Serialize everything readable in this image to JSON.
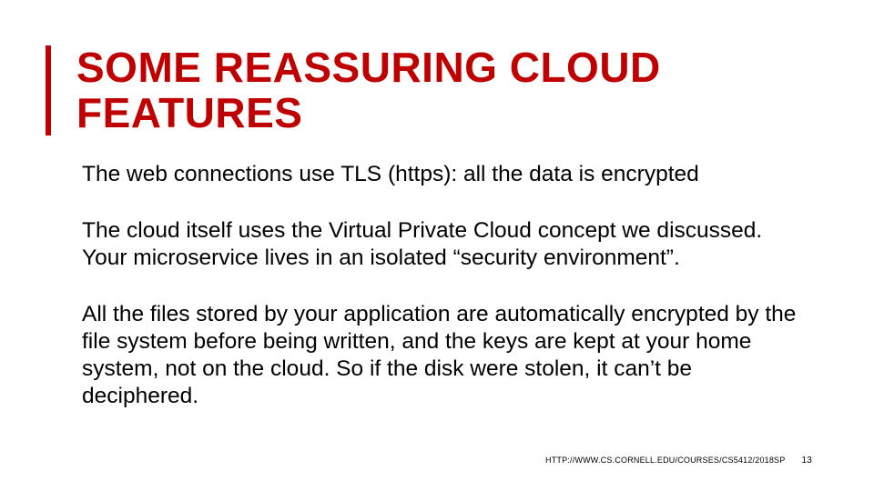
{
  "title": "SOME REASSURING CLOUD FEATURES",
  "paragraphs": [
    "The web connections use TLS (https): all the data is encrypted",
    "The cloud itself uses the Virtual Private Cloud concept we discussed.  Your microservice lives in an isolated “security environment”.",
    "All the files stored by your application are automatically encrypted by the file system before being written, and the keys are kept at your home system, not on the cloud.  So if the disk were stolen, it can’t be deciphered."
  ],
  "footer": {
    "source": "HTTP://WWW.CS.CORNELL.EDU/COURSES/CS5412/2018SP",
    "page": "13"
  }
}
